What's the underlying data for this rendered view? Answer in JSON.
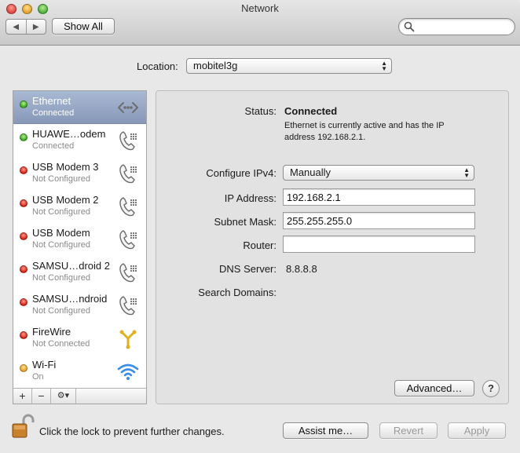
{
  "window": {
    "title": "Network"
  },
  "toolbar": {
    "back_glyph": "◀",
    "forward_glyph": "▶",
    "show_all_label": "Show All",
    "search_placeholder": "",
    "search_icon": "magnifier-icon"
  },
  "location": {
    "label": "Location:",
    "value": "mobitel3g"
  },
  "services": [
    {
      "name": "Ethernet",
      "status": "Connected",
      "dot": "green",
      "icon": "ethernet-icon",
      "selected": true
    },
    {
      "name": "HUAWE…odem",
      "status": "Connected",
      "dot": "green",
      "icon": "phone-icon",
      "selected": false
    },
    {
      "name": "USB Modem 3",
      "status": "Not Configured",
      "dot": "red",
      "icon": "phone-icon",
      "selected": false
    },
    {
      "name": "USB Modem 2",
      "status": "Not Configured",
      "dot": "red",
      "icon": "phone-icon",
      "selected": false
    },
    {
      "name": "USB Modem",
      "status": "Not Configured",
      "dot": "red",
      "icon": "phone-icon",
      "selected": false
    },
    {
      "name": "SAMSU…droid 2",
      "status": "Not Configured",
      "dot": "red",
      "icon": "phone-icon",
      "selected": false
    },
    {
      "name": "SAMSU…ndroid",
      "status": "Not Configured",
      "dot": "red",
      "icon": "phone-icon",
      "selected": false
    },
    {
      "name": "FireWire",
      "status": "Not Connected",
      "dot": "red",
      "icon": "firewire-icon",
      "selected": false
    },
    {
      "name": "Wi-Fi",
      "status": "On",
      "dot": "yellow",
      "icon": "wifi-icon",
      "selected": false
    }
  ],
  "sidebar_footer": {
    "add": "+",
    "remove": "−",
    "action": "⚙▾"
  },
  "detail": {
    "status_label": "Status:",
    "status_value": "Connected",
    "status_desc_line1": "Ethernet is currently active and has the IP",
    "status_desc_line2": "address 192.168.2.1.",
    "configure_label": "Configure IPv4:",
    "configure_value": "Manually",
    "ip_label": "IP Address:",
    "ip_value": "192.168.2.1",
    "subnet_label": "Subnet Mask:",
    "subnet_value": "255.255.255.0",
    "router_label": "Router:",
    "router_value": "",
    "dns_label": "DNS Server:",
    "dns_value": "8.8.8.8",
    "search_domains_label": "Search Domains:",
    "advanced_label": "Advanced…",
    "help_label": "?"
  },
  "footer": {
    "lock_text": "Click the lock to prevent further changes.",
    "assist_label": "Assist me…",
    "revert_label": "Revert",
    "apply_label": "Apply"
  },
  "colors": {
    "selection": "#8d9dbc",
    "status_green": "#2fa318",
    "status_red": "#d01a0c",
    "status_yellow": "#e29a16"
  }
}
